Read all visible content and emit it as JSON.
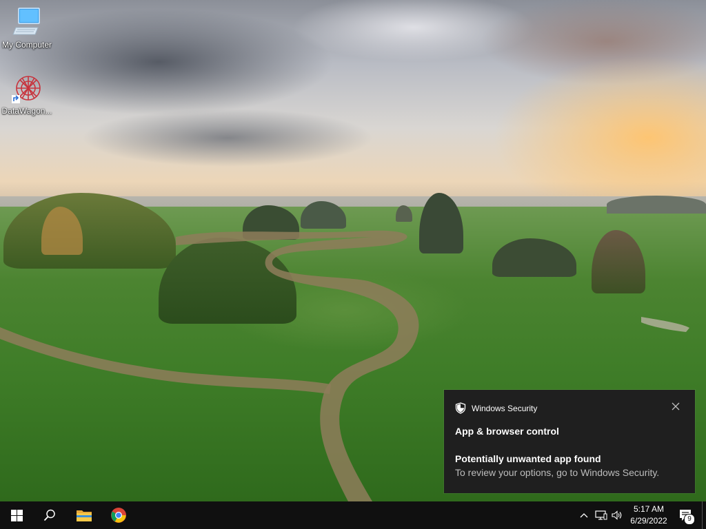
{
  "desktop": {
    "icons": [
      {
        "label": "My Computer",
        "icon": "computer-icon"
      },
      {
        "label": "DataWagon...",
        "icon": "datawagon-app-icon"
      }
    ]
  },
  "notification": {
    "app_name": "Windows Security",
    "title": "App & browser control",
    "subtitle": "Potentially unwanted app found",
    "body": "To review your options, go to Windows Security.",
    "icons": {
      "app": "shield-icon",
      "close": "close-icon"
    },
    "background": "#1f1f1f"
  },
  "taskbar": {
    "start_icon": "windows-start-icon",
    "search_icon": "search-icon",
    "pinned": [
      {
        "name": "File Explorer",
        "icon": "folder-icon"
      },
      {
        "name": "Google Chrome",
        "icon": "chrome-icon"
      }
    ],
    "tray": {
      "icons": [
        "chevron-up-icon",
        "network-icon",
        "volume-icon"
      ],
      "time": "5:17 AM",
      "date": "6/29/2022",
      "notification_count": "9"
    },
    "background": "#101010"
  }
}
